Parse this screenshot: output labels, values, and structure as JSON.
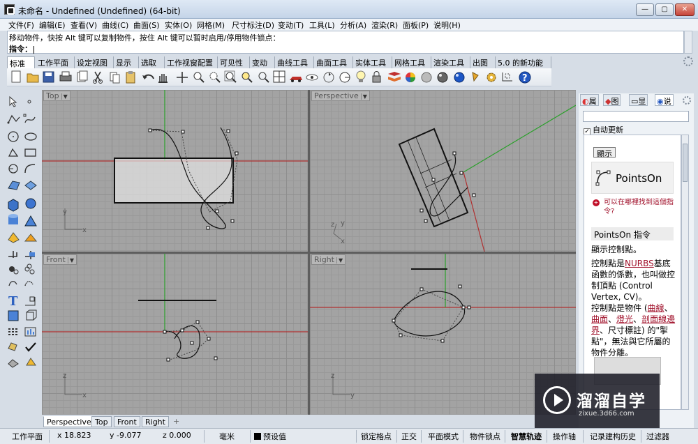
{
  "window": {
    "title": "未命名 - Undefined (Undefined) (64-bit)",
    "minimize_label": "—",
    "maximize_label": "▢",
    "close_label": "✕"
  },
  "menubar": [
    "文件(F)",
    "编辑(E)",
    "查看(V)",
    "曲线(C)",
    "曲面(S)",
    "实体(O)",
    "网格(M)",
    "尺寸标注(D)",
    "变动(T)",
    "工具(L)",
    "分析(A)",
    "渲染(R)",
    "面板(P)",
    "说明(H)"
  ],
  "command": {
    "history": "移动物件，快按 Alt 键可以复制物件，按住 Alt 键可以暂时启用/停用物件锁点：",
    "prompt": "指令："
  },
  "toolbar_tabs": [
    "标准",
    "工作平面",
    "设定视图",
    "显示",
    "选取",
    "工作视窗配置",
    "可见性",
    "变动",
    "曲线工具",
    "曲面工具",
    "实体工具",
    "网格工具",
    "渲染工具",
    "出图",
    "5.0 的新功能"
  ],
  "toolbar_active_tab": "标准",
  "toolbar_icons": [
    "new-file-icon",
    "open-folder-icon",
    "save-icon",
    "print-icon",
    "import-icon",
    "cut-icon",
    "copy-icon",
    "paste-icon",
    "undo-icon",
    "pan-hand-icon",
    "move-view-icon",
    "zoom-icon",
    "zoom-window-icon",
    "zoom-extents-icon",
    "zoom-selected-icon",
    "rotate-view-icon",
    "four-viewports-icon",
    "car-icon",
    "eye-icon",
    "rotate-icon",
    "light-bulb-icon",
    "lock-icon",
    "layers-icon",
    "color-wheel-icon",
    "sphere-icon",
    "render-sphere-icon",
    "blue-sphere-icon",
    "spotlight-icon",
    "settings-gear-icon",
    "grid-snap-icon",
    "help-icon"
  ],
  "left_tools": [
    "select-arrow-icon",
    "point-icon",
    "polyline-icon",
    "curve-icon",
    "circle-icon",
    "ellipse-icon",
    "arc-icon",
    "rectangle-icon",
    "arc-center-icon",
    "fillet-curve-icon",
    "surface-icon",
    "patch-icon",
    "box-icon",
    "sphere-solid-icon",
    "cylinder-icon",
    "cone-icon",
    "mesh-icon",
    "boolean-icon",
    "trim-icon",
    "split-icon",
    "explode-icon",
    "join-icon",
    "group-icon",
    "ungroup-icon",
    "text-icon",
    "dimension-icon",
    "block-icon",
    "array-icon",
    "grid-array-icon",
    "check-icon",
    "analyze-icon",
    "render-icon"
  ],
  "viewports": {
    "top": {
      "label": "Top",
      "axis_y": "y",
      "axis_x": "x"
    },
    "perspective": {
      "label": "Perspective",
      "axis_z": "z",
      "axis_y": "y",
      "axis_x": "x"
    },
    "front": {
      "label": "Front",
      "axis_z": "z",
      "axis_x": "x"
    },
    "right": {
      "label": "Right",
      "axis_z": "z",
      "axis_y": "y"
    }
  },
  "viewport_tabs": [
    "Perspective",
    "Top",
    "Front",
    "Right",
    "+"
  ],
  "active_viewport_tab": "Perspective",
  "statusbar": {
    "cplane": "工作平面",
    "x": "x 18.823",
    "y": "y -9.077",
    "z": "z 0.000",
    "unit": "毫米",
    "layer": "预设值",
    "osnap": "锁定格点",
    "ortho": "正交",
    "planar": "平面模式",
    "object_snap": "物件锁点",
    "smart_track": "智慧轨迹",
    "gumball": "操作轴",
    "history": "记录建构历史",
    "filter": "过滤器"
  },
  "right_panel": {
    "tabs": [
      "属",
      "图",
      "显",
      "说"
    ],
    "active_tab": "说",
    "auto_update": "自动更新",
    "show_button": "顯示",
    "command_name": "PointsOn",
    "hint": "可以在哪裡找到這個指令?",
    "section_title": "PointsOn 指令",
    "p1": "顯示控制點。",
    "p2_pre": "控制點是",
    "p2_link": "NURBS",
    "p2_post": "基底函數的係數，也叫做控制頂點 (Control Vertex, CV)。",
    "p3_pre": "控制點是物件 (",
    "p3_link1": "曲線",
    "p3_sep1": "、",
    "p3_link2": "曲面",
    "p3_sep2": "、",
    "p3_link3": "燈光",
    "p3_sep3": "、",
    "p3_link4": "剖面線邊界",
    "p3_post": "、尺寸標註) 的\"掣點\"，無法與它所屬的物件分離。"
  },
  "watermark": {
    "name": "溜溜自学",
    "url": "zixue.3d66.com"
  },
  "colors": {
    "viewport_bg": "#a3a3a3",
    "x_axis": "#b03030",
    "y_axis": "#2aa02a",
    "link": "#a0102a"
  }
}
